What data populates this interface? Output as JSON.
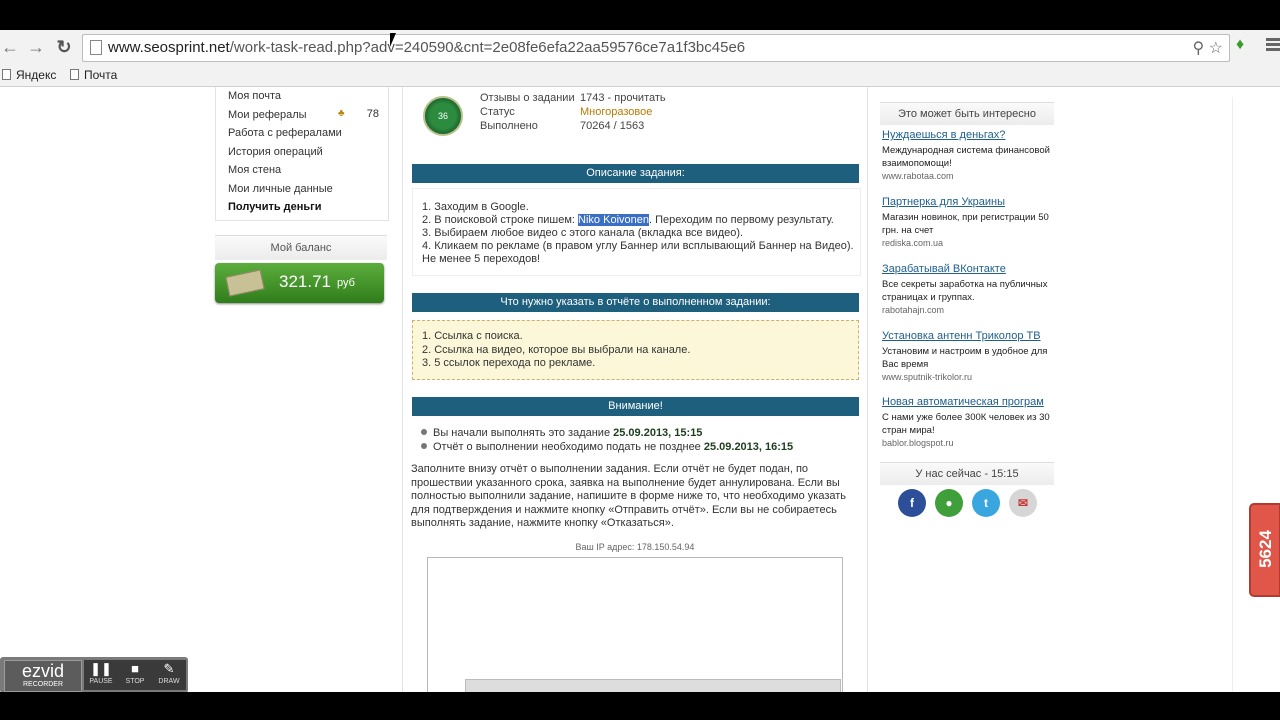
{
  "browser": {
    "url_host": "www.seosprint.net",
    "url_path": "/work-task-read.php?adv=240590&cnt=2e08fe6efa22aa59576ce7a1f3bc45e6",
    "bookmarks": [
      "Яндекс",
      "Почта"
    ]
  },
  "left_menu": {
    "items": [
      "Моя почта",
      "Мои рефералы",
      "Работа с рефералами",
      "История операций",
      "Моя стена",
      "Мои личные данные",
      "Получить деньги"
    ],
    "referrals_count": "78"
  },
  "balance": {
    "header": "Мой баланс",
    "amount": "321.71",
    "currency": "руб"
  },
  "task": {
    "level": "36",
    "stats": [
      {
        "label": "Отзывы о задании",
        "value": "1743 - прочитать"
      },
      {
        "label": "Статус",
        "value": "Многоразовое"
      },
      {
        "label": "Выполнено",
        "value": "70264 / 1563"
      }
    ],
    "description_header": "Описание задания:",
    "description": {
      "line1": "1. Заходим в Google.",
      "line2_before": "2. В поисковой строке пишем: ",
      "line2_highlight": "Niko Koivonen",
      "line2_after": ". Переходим по первому результату.",
      "line3": "3. Выбираем любое видео с этого канала (вкладка все видео).",
      "line4": "4. Кликаем по рекламе (в правом углу Баннер или всплывающий Баннер на Видео).",
      "line5": "Не менее 5 переходов!"
    },
    "report_header": "Что нужно указать в отчёте о выполненном задании:",
    "report_items": [
      "1. Ссылка с поиска.",
      "2. Ссылка на видео, которое вы выбрали на канале.",
      "3. 5 ссылок перехода по рекламе."
    ],
    "warning_header": "Внимание!",
    "warning1_text": "Вы начали выполнять это задание ",
    "warning1_date": "25.09.2013, 15:15",
    "warning2_text": "Отчёт о выполнении необходимо подать не позднее ",
    "warning2_date": "25.09.2013, 16:15",
    "instructions": "Заполните внизу отчёт о выполнении задания. Если отчёт не будет подан, по прошествии указанного срока, заявка на выполнение будет аннулирована. Если вы полностью выполнили задание, напишите в форме ниже то, что необходимо указать для подтверждения и нажмите кнопку «Отправить отчёт». Если вы не собираетесь выполнять задание, нажмите кнопку «Отказаться».",
    "ip_text": "Ваш IP адрес: 178.150.54.94"
  },
  "right_col": {
    "header": "Это может быть интересно",
    "ads": [
      {
        "title": "Нуждаешься в деньгах?",
        "text": "Международная система финансовой взаимопомощи!",
        "url": "www.rabotaa.com"
      },
      {
        "title": "Партнерка для Украины",
        "text": "Магазин новинок, при регистрации 50 грн. на счет",
        "url": "rediska.com.ua"
      },
      {
        "title": "Зарабатывай ВКонтакте",
        "text": "Все секреты заработка на публичных страницах и группах.",
        "url": "rabotahajn.com"
      },
      {
        "title": "Установка антенн Триколор ТВ",
        "text": "Установим и настроим в удобное для Вас время",
        "url": "www.sputnik-trikolor.ru"
      },
      {
        "title": "Новая автоматическая програм",
        "text": "С нами уже более 300К человек из 30 стран мира!",
        "url": "bablor.blogspot.ru"
      }
    ],
    "online_header": "У нас сейчас - 15:15"
  },
  "side_tab": "5624",
  "recorder": {
    "logo": "ezvid",
    "logo_sub": "RECORDER",
    "pause": "PAUSE",
    "stop": "STOP",
    "draw": "DRAW"
  },
  "colors": {
    "section_bar": "#1f5f7e",
    "balance_green": "#3f8f2a",
    "link_blue": "#1e5f8c",
    "side_tab_red": "#e0574a"
  }
}
